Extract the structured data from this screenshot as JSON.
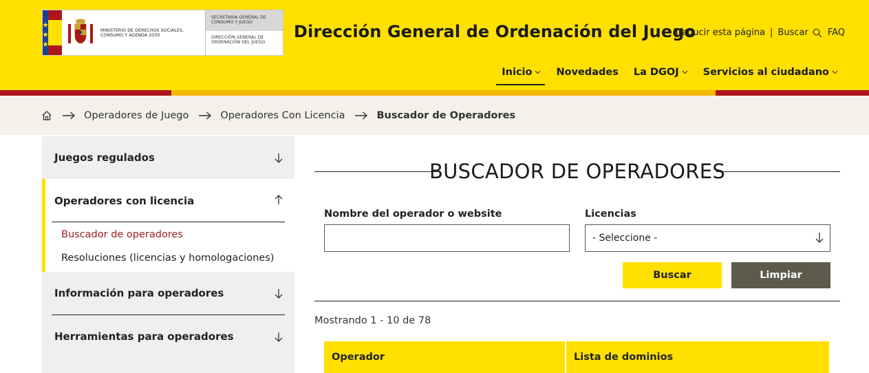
{
  "header": {
    "logo": {
      "ministry": "MINISTERIO DE DERECHOS SOCIALES, CONSUMO Y AGENDA 2030",
      "secretaria": "SECRETARÍA GENERAL DE CONSUMO Y JUEGO",
      "direccion": "DIRECCIÓN GENERAL DE ORDENACIÓN DEL JUEGO"
    },
    "site_title": "Dirección General de Ordenación del Juego",
    "top_links": {
      "translate": "Traducir esta página",
      "separator": "|",
      "search": "Buscar",
      "faq": "FAQ"
    },
    "nav": [
      {
        "label": "Inicio",
        "has_dropdown": true,
        "active": true
      },
      {
        "label": "Novedades",
        "has_dropdown": false
      },
      {
        "label": "La DGOJ",
        "has_dropdown": true
      },
      {
        "label": "Servicios al ciudadano",
        "has_dropdown": true
      }
    ]
  },
  "breadcrumb": {
    "items": [
      "Operadores de Juego",
      "Operadores Con Licencia"
    ],
    "current": "Buscador de Operadores"
  },
  "sidebar": {
    "sections": [
      {
        "title": "Juegos regulados",
        "expanded": false
      },
      {
        "title": "Operadores con licencia",
        "expanded": true,
        "children": [
          {
            "label": "Buscador de operadores",
            "current": true
          },
          {
            "label": "Resoluciones (licencias y homologaciones)",
            "current": false
          }
        ]
      },
      {
        "title": "Información para operadores",
        "expanded": false
      },
      {
        "title": "Herramientas para operadores",
        "expanded": false
      }
    ]
  },
  "main": {
    "heading": "BUSCADOR DE OPERADORES",
    "form": {
      "operator_label": "Nombre del operador o website",
      "operator_value": "",
      "licencias_label": "Licencias",
      "licencias_selected": "- Seleccione -",
      "search_button": "Buscar",
      "clear_button": "Limpiar"
    },
    "results_count": "Mostrando 1 - 10 de 78",
    "table": {
      "headers": [
        "Operador",
        "Lista de dominios"
      ]
    }
  },
  "colors": {
    "brand_yellow": "#FFE000",
    "brand_red": "#AD1519",
    "accent_orange": "#F5B800",
    "clear_button_bg": "#5C5A4C",
    "breadcrumb_bg": "#F3F1EA",
    "sidebar_bg": "#F0EFED",
    "current_link": "#9B1C1F"
  }
}
